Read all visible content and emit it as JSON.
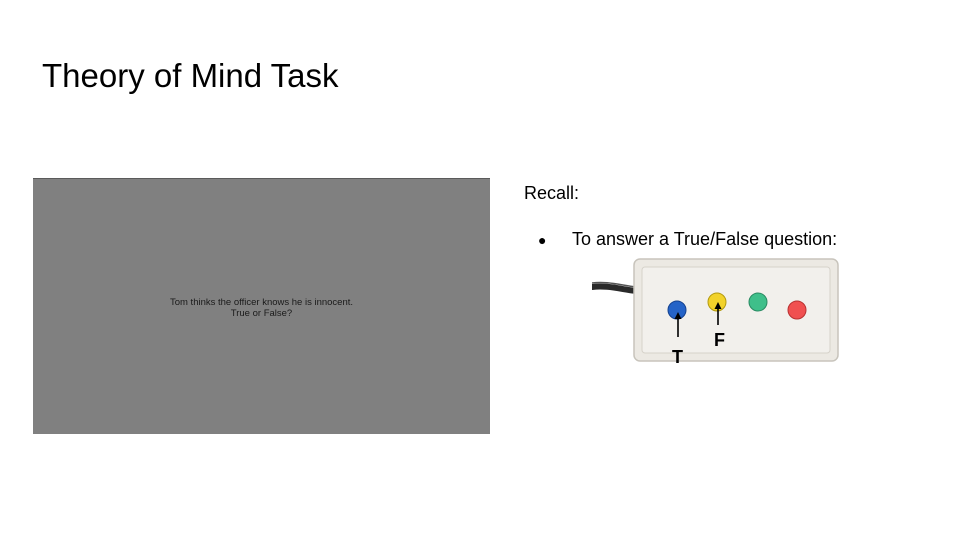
{
  "slide": {
    "title": "Theory of Mind Task"
  },
  "task_screen": {
    "line1": "Tom thinks the officer knows he is innocent.",
    "line2": "True or False?",
    "background_color": "#808080"
  },
  "recall": {
    "heading": "Recall:",
    "bullet": "To answer a True/False question:"
  },
  "response_box": {
    "buttons": [
      {
        "color": "blue",
        "hex": "#2563c7"
      },
      {
        "color": "yellow",
        "hex": "#f2d22a"
      },
      {
        "color": "green",
        "hex": "#3fbf8a"
      },
      {
        "color": "red",
        "hex": "#f05050"
      }
    ],
    "true_label": "T",
    "false_label": "F"
  }
}
